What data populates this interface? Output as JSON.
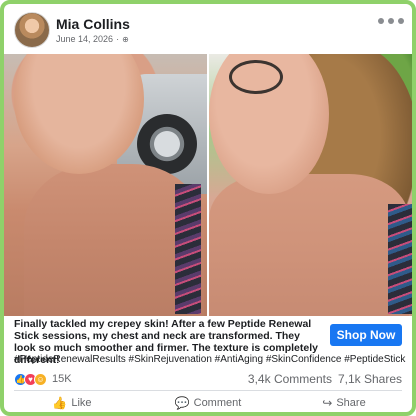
{
  "post": {
    "author": "Mia Collins",
    "date": "June 14, 2026",
    "audience_icon": "globe-icon",
    "more_icon": "more-options-icon"
  },
  "caption": {
    "text": "Finally tackled my crepey skin! After a few Peptide Renewal Stick sessions, my chest and neck are transformed. They look so much smoother and firmer. The texture is completely different!",
    "hashtags": "#PeptideRenewalResults #SkinRejuvenation #AntiAging #SkinConfidence #PeptideStick"
  },
  "cta": {
    "label": "Shop Now",
    "color": "#1877f2"
  },
  "stats": {
    "reactions_count": "15K",
    "reaction_icons": [
      "like-icon",
      "love-icon",
      "care-icon"
    ],
    "comments": "3,4k Comments",
    "shares": "7,1k Shares"
  },
  "actions": [
    {
      "label": "Like",
      "icon": "thumbs-up-icon"
    },
    {
      "label": "Comment",
      "icon": "comment-icon"
    },
    {
      "label": "Share",
      "icon": "share-icon"
    }
  ],
  "colors": {
    "frame_border": "#8fd16a",
    "text": "#1c1e21",
    "muted": "#65676b"
  }
}
